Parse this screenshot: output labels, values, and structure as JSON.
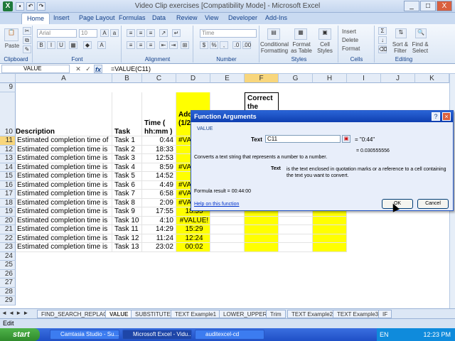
{
  "window": {
    "title": "Video Clip exercises  [Compatibility Mode] - Microsoft Excel",
    "app_icon": "X",
    "buttons": [
      "_",
      "□",
      "X"
    ]
  },
  "ribbon_tabs": [
    "Home",
    "Insert",
    "Page Layout",
    "Formulas",
    "Data",
    "Review",
    "View",
    "Developer",
    "Add-Ins"
  ],
  "ribbon": {
    "paste": "Paste",
    "font_name": "Arial",
    "font_size": "10",
    "number_format": "Time",
    "conditional_formatting": "Conditional Formatting",
    "format_as_table": "Format as Table",
    "cell_styles": "Cell Styles",
    "insert": "Insert",
    "delete": "Delete",
    "format": "Format",
    "sort_filter": "Sort & Filter",
    "find_select": "Find & Select",
    "groups": [
      "Clipboard",
      "Font",
      "Alignment",
      "Number",
      "Styles",
      "Cells",
      "Editing"
    ]
  },
  "formula_bar": {
    "name_box": "VALUE",
    "cancel": "✕",
    "enter": "✓",
    "fx": "fx",
    "formula": "=VALUE(C11)"
  },
  "columns": [
    "A",
    "B",
    "C",
    "D",
    "E",
    "F",
    "G",
    "H",
    "I",
    "J",
    "K"
  ],
  "headers": {
    "a": "Description",
    "b": "Task",
    "c": "Time ( hh:mm )",
    "d": "Add hou (1/24",
    "f": "Correct the"
  },
  "rows": [
    {
      "n": "11",
      "a": "Estimated completion time of",
      "b": "Task 1",
      "c": "0:44",
      "d": "#VA"
    },
    {
      "n": "12",
      "a": "Estimated completion time is",
      "b": "Task 2",
      "c": "18:33",
      "d": ""
    },
    {
      "n": "13",
      "a": "Estimated completion time is",
      "b": "Task 3",
      "c": "12:53",
      "d": ""
    },
    {
      "n": "14",
      "a": "Estimated completion time is",
      "b": "Task 4",
      "c": "8:59",
      "d": "#VA"
    },
    {
      "n": "15",
      "a": "Estimated completion time is",
      "b": "Task 5",
      "c": "14:52",
      "d": ""
    },
    {
      "n": "16",
      "a": "Estimated completion time is",
      "b": "Task 6",
      "c": "4:49",
      "d": "#VA"
    },
    {
      "n": "17",
      "a": "Estimated completion time is",
      "b": "Task 7",
      "c": "6:58",
      "d": "#VA"
    },
    {
      "n": "18",
      "a": "Estimated completion time is",
      "b": "Task 8",
      "c": "2:09",
      "d": "#VA"
    },
    {
      "n": "19",
      "a": "Estimated completion time is",
      "b": "Task 9",
      "c": "17:55",
      "d": "18:55"
    },
    {
      "n": "20",
      "a": "Estimated completion time is",
      "b": "Task 10",
      "c": "4:10",
      "d": "#VALUE!"
    },
    {
      "n": "21",
      "a": "Estimated completion time is",
      "b": "Task 11",
      "c": "14:29",
      "d": "15:29"
    },
    {
      "n": "22",
      "a": "Estimated completion time is",
      "b": "Task 12",
      "c": "11:24",
      "d": "12:24"
    },
    {
      "n": "23",
      "a": "Estimated completion time is",
      "b": "Task 13",
      "c": "23:02",
      "d": "00:02"
    }
  ],
  "empty_rows": [
    "24",
    "25",
    "26",
    "27",
    "28",
    "29"
  ],
  "top_rows": [
    "9",
    "10"
  ],
  "sheet_tabs": [
    "FIND_SEARCH_REPLACE",
    "VALUE",
    "SUBSTITUTE",
    "TEXT Example1",
    "LOWER_UPPER",
    "Trim",
    "TEXT Example2",
    "TEXT Example3",
    "IF"
  ],
  "active_sheet": "VALUE",
  "status": "Edit",
  "dialog": {
    "title": "Function Arguments",
    "function": "VALUE",
    "arg_label": "Text",
    "arg_value": "C11",
    "arg_eval": "= \"0:44\"",
    "result_eval": "= 0.030555556",
    "description": "Converts a text string that represents a number to a number.",
    "arg_name": "Text",
    "arg_desc": "is the text enclosed in quotation marks or a reference to a cell containing the text you want to convert.",
    "formula_result_label": "Formula result =",
    "formula_result": "00:44:00",
    "help_link": "Help on this function",
    "ok": "OK",
    "cancel": "Cancel"
  },
  "taskbar": {
    "start": "start",
    "items": [
      "Camtasia Studio - Su...",
      "Microsoft Excel - Vidu...",
      "auditexcel-cd"
    ],
    "lang": "EN",
    "time": "12:23 PM"
  },
  "colors": {
    "highlight": "#ffff00",
    "selected_header": "#f8d67c",
    "dialog_title": "#0f3fb0"
  }
}
